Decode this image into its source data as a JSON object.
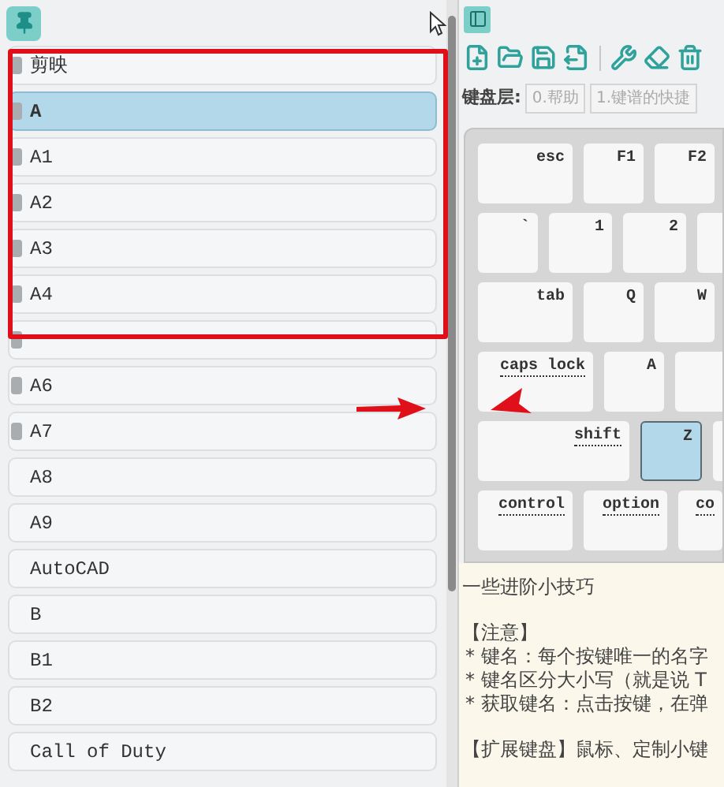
{
  "presets": {
    "items": [
      {
        "label": "剪映",
        "selected": false,
        "badge": true
      },
      {
        "label": "A",
        "selected": true,
        "badge": true
      },
      {
        "label": "A1",
        "selected": false,
        "badge": true
      },
      {
        "label": "A2",
        "selected": false,
        "badge": true
      },
      {
        "label": "A3",
        "selected": false,
        "badge": true
      },
      {
        "label": "A4",
        "selected": false,
        "badge": true
      },
      {
        "selected": false,
        "badge": true
      },
      {
        "label": "A6",
        "selected": false,
        "badge": true
      },
      {
        "label": "A7",
        "selected": false,
        "badge": true
      },
      {
        "label": "A8",
        "selected": false,
        "badge": false
      },
      {
        "label": "A9",
        "selected": false,
        "badge": false
      },
      {
        "label": "AutoCAD",
        "selected": false,
        "badge": false
      },
      {
        "label": "B",
        "selected": false,
        "badge": false
      },
      {
        "label": "B1",
        "selected": false,
        "badge": false
      },
      {
        "label": "B2",
        "selected": false,
        "badge": false
      },
      {
        "label": "Call of Duty",
        "selected": false,
        "badge": false
      }
    ]
  },
  "layers": {
    "label": "键盘层:",
    "tabs": [
      "0.帮助",
      "1.键谱的快捷"
    ]
  },
  "keyboard": {
    "rows": [
      {
        "keys": [
          {
            "label": "esc",
            "selected": false,
            "dotted": false
          },
          {
            "label": "F1",
            "selected": false,
            "dotted": false
          },
          {
            "label": "F2",
            "selected": false,
            "dotted": false
          }
        ]
      },
      {
        "keys": [
          {
            "label": "`",
            "selected": false,
            "dotted": false
          },
          {
            "label": "1",
            "selected": false,
            "dotted": false
          },
          {
            "label": "2",
            "selected": false,
            "dotted": false
          }
        ]
      },
      {
        "keys": [
          {
            "label": "tab",
            "selected": false,
            "dotted": false
          },
          {
            "label": "Q",
            "selected": false,
            "dotted": false
          },
          {
            "label": "W",
            "selected": false,
            "dotted": false
          }
        ]
      },
      {
        "keys": [
          {
            "label": "caps lock",
            "selected": false,
            "dotted": true
          },
          {
            "label": "A",
            "selected": false,
            "dotted": false
          }
        ]
      },
      {
        "keys": [
          {
            "label": "shift",
            "selected": false,
            "dotted": true
          },
          {
            "label": "Z",
            "selected": true,
            "dotted": false
          }
        ]
      },
      {
        "keys": [
          {
            "label": "control",
            "selected": false,
            "dotted": true
          },
          {
            "label": "option",
            "selected": false,
            "dotted": true
          },
          {
            "label": "co",
            "selected": false,
            "dotted": true
          }
        ]
      }
    ]
  },
  "tips": [
    {
      "kind": "title",
      "text": "一些进阶小技巧"
    },
    {
      "kind": "heading",
      "text": "【注意】"
    },
    {
      "kind": "bullet",
      "text": "* 键名：每个按键唯一的名字"
    },
    {
      "kind": "bullet",
      "text": "* 键名区分大小写（就是说 T"
    },
    {
      "kind": "bullet",
      "text": "* 获取键名：点击按键，在弹"
    },
    {
      "kind": "heading",
      "text": "【扩展键盘】鼠标、定制小键"
    }
  ]
}
